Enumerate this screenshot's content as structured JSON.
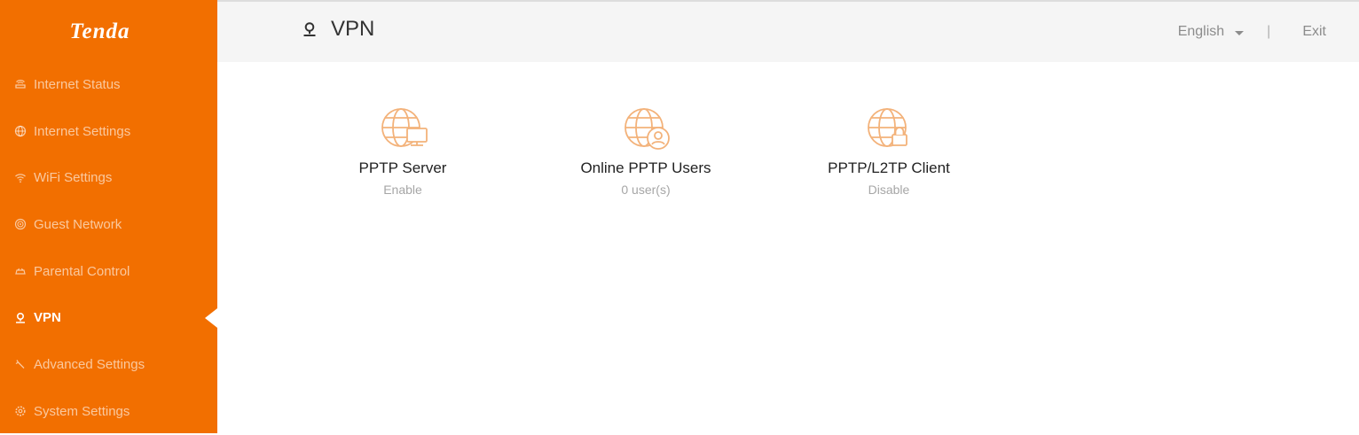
{
  "brand": {
    "logo_text": "Tenda",
    "accent": "#f26f00"
  },
  "sidebar": {
    "items": [
      {
        "label": "Internet Status",
        "icon": "router-icon",
        "active": false
      },
      {
        "label": "Internet Settings",
        "icon": "globe-icon",
        "active": false
      },
      {
        "label": "WiFi Settings",
        "icon": "wifi-icon",
        "active": false
      },
      {
        "label": "Guest Network",
        "icon": "guest-network-icon",
        "active": false
      },
      {
        "label": "Parental Control",
        "icon": "parental-control-icon",
        "active": false
      },
      {
        "label": "VPN",
        "icon": "vpn-icon",
        "active": true
      },
      {
        "label": "Advanced Settings",
        "icon": "wrench-icon",
        "active": false
      },
      {
        "label": "System Settings",
        "icon": "gear-icon",
        "active": false
      }
    ]
  },
  "header": {
    "title": "VPN",
    "title_icon": "vpn-icon",
    "language": "English",
    "separator": "|",
    "exit_label": "Exit"
  },
  "cards": [
    {
      "title": "PPTP Server",
      "status": "Enable",
      "icon": "globe-monitor-icon"
    },
    {
      "title": "Online PPTP Users",
      "status": "0 user(s)",
      "icon": "globe-user-icon"
    },
    {
      "title": "PPTP/L2TP Client",
      "status": "Disable",
      "icon": "globe-lock-icon"
    }
  ]
}
